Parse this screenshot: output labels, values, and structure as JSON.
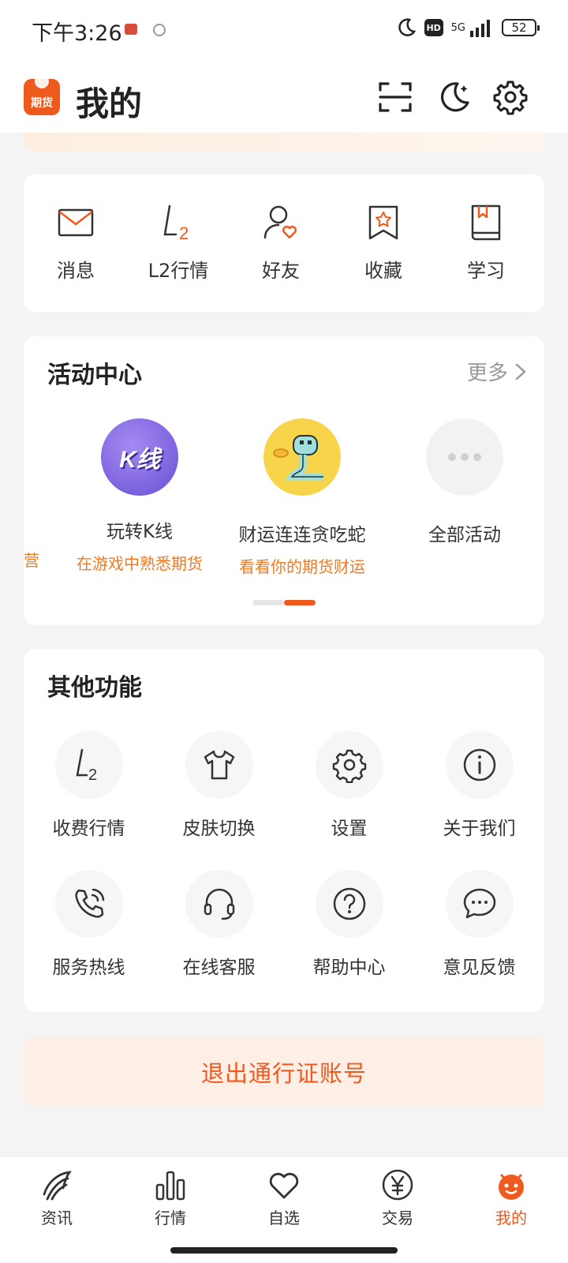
{
  "status_bar": {
    "time": "下午3:26",
    "network": "5G",
    "battery": "52",
    "hd": "HD"
  },
  "header": {
    "logo_text": "期货",
    "title": "我的"
  },
  "quick_actions": [
    {
      "label": "消息",
      "icon": "mail-icon"
    },
    {
      "label": "L2行情",
      "icon": "l2-icon"
    },
    {
      "label": "好友",
      "icon": "friend-icon"
    },
    {
      "label": "收藏",
      "icon": "bookmark-star-icon"
    },
    {
      "label": "学习",
      "icon": "book-icon"
    }
  ],
  "activity": {
    "title": "活动中心",
    "more": "更多",
    "partial_desc": "营",
    "items": [
      {
        "name": "玩转K线",
        "desc": "在游戏中熟悉期货",
        "icon": "kline-game-icon",
        "badge": "K线"
      },
      {
        "name": "财运连连贪吃蛇",
        "desc": "看看你的期货财运",
        "icon": "snake-game-icon"
      },
      {
        "name": "全部活动",
        "desc": "",
        "icon": "more-dots-icon"
      }
    ],
    "page_index": 2,
    "page_count": 2
  },
  "other": {
    "title": "其他功能",
    "items": [
      {
        "label": "收费行情",
        "icon": "l2-icon"
      },
      {
        "label": "皮肤切换",
        "icon": "tshirt-icon"
      },
      {
        "label": "设置",
        "icon": "gear-icon"
      },
      {
        "label": "关于我们",
        "icon": "info-icon"
      },
      {
        "label": "服务热线",
        "icon": "phone-icon"
      },
      {
        "label": "在线客服",
        "icon": "headset-icon"
      },
      {
        "label": "帮助中心",
        "icon": "help-icon"
      },
      {
        "label": "意见反馈",
        "icon": "chat-icon"
      }
    ]
  },
  "logout": {
    "label": "退出通行证账号"
  },
  "bottom_nav": [
    {
      "label": "资讯",
      "icon": "news-icon"
    },
    {
      "label": "行情",
      "icon": "bars-icon"
    },
    {
      "label": "自选",
      "icon": "heart-icon"
    },
    {
      "label": "交易",
      "icon": "yen-icon"
    },
    {
      "label": "我的",
      "icon": "mine-icon",
      "active": true
    }
  ],
  "colors": {
    "accent": "#ef5a1e",
    "orange_text": "#ee7a22",
    "background": "#f4f4f4"
  }
}
